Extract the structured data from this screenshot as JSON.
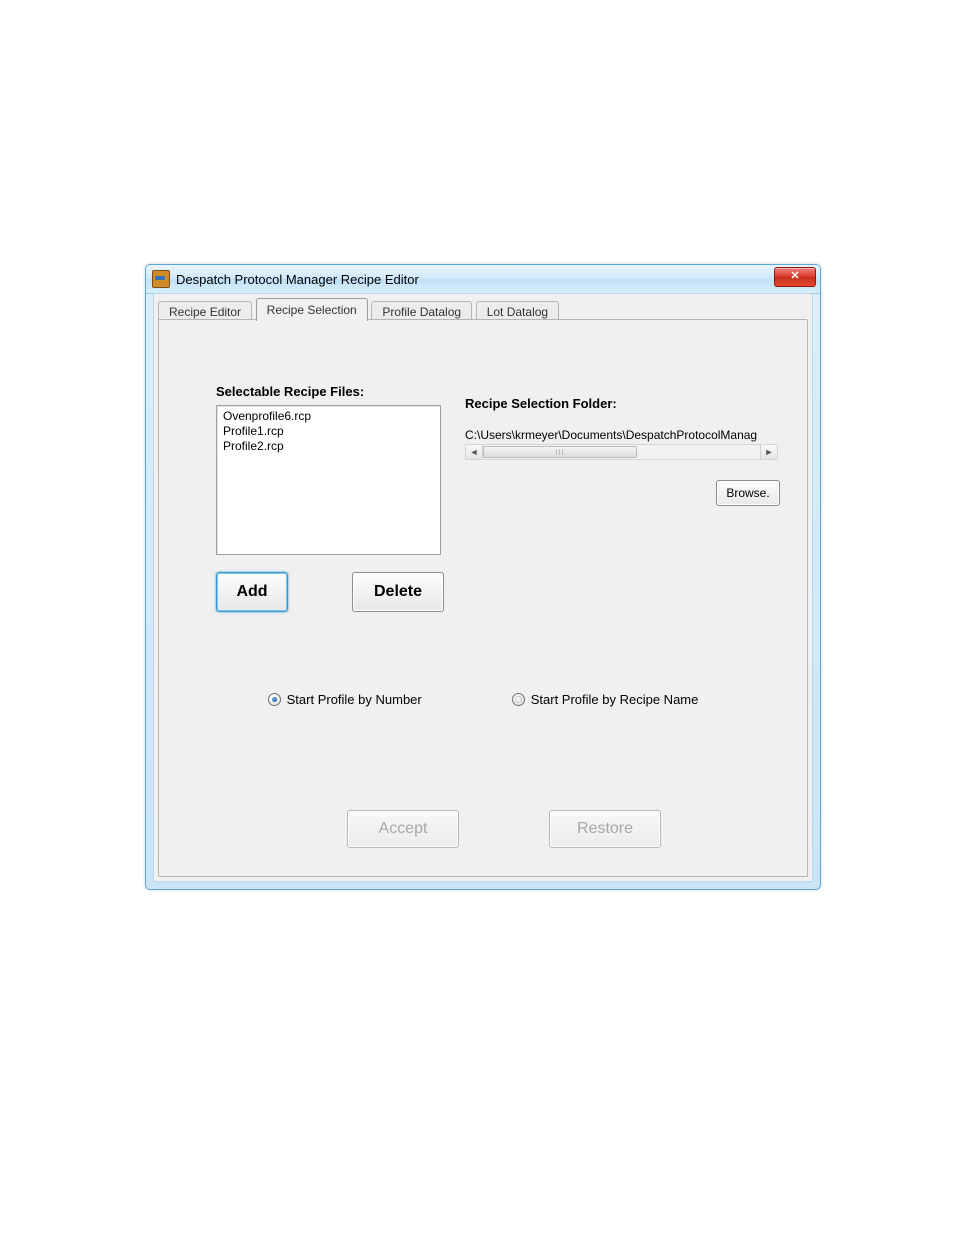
{
  "window": {
    "title": "Despatch Protocol Manager Recipe Editor",
    "close_glyph": "✕"
  },
  "tabs": {
    "items": [
      "Recipe Editor",
      "Recipe Selection",
      "Profile Datalog",
      "Lot Datalog"
    ],
    "active_index": 1
  },
  "left": {
    "files_label": "Selectable Recipe Files:",
    "files": [
      "Ovenprofile6.rcp",
      "Profile1.rcp",
      "Profile2.rcp"
    ],
    "add_label": "Add",
    "delete_label": "Delete"
  },
  "right": {
    "folder_label": "Recipe Selection Folder:",
    "path_value": "C:\\Users\\krmeyer\\Documents\\DespatchProtocolManag",
    "browse_label": "Browse."
  },
  "radios": {
    "by_number_label": "Start Profile by Number",
    "by_name_label": "Start Profile by Recipe Name",
    "selected": "number"
  },
  "bottom": {
    "accept_label": "Accept",
    "restore_label": "Restore"
  }
}
